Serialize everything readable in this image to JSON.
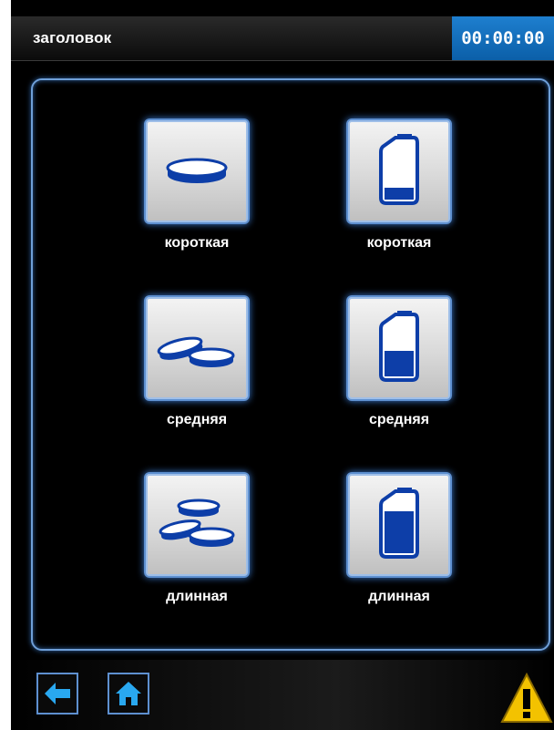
{
  "header": {
    "title": "заголовок",
    "clock": "00:00:00"
  },
  "grid": {
    "left_column": [
      {
        "label": "короткая",
        "icon": "single-dish-icon"
      },
      {
        "label": "средняя",
        "icon": "two-dishes-icon"
      },
      {
        "label": "длинная",
        "icon": "three-dishes-icon"
      }
    ],
    "right_column": [
      {
        "label": "короткая",
        "icon": "canister-low-icon",
        "fill_level": 0.25
      },
      {
        "label": "средняя",
        "icon": "canister-medium-icon",
        "fill_level": 0.5
      },
      {
        "label": "длинная",
        "icon": "canister-high-icon",
        "fill_level": 0.75
      }
    ]
  },
  "footer": {
    "back_icon": "arrow-left-icon",
    "home_icon": "home-icon",
    "warning_icon": "warning-icon"
  },
  "colors": {
    "accent_blue": "#0d3ea8",
    "clock_bg": "#1473c4",
    "panel_border": "#6f9fd8",
    "warning_yellow": "#f3c200"
  }
}
